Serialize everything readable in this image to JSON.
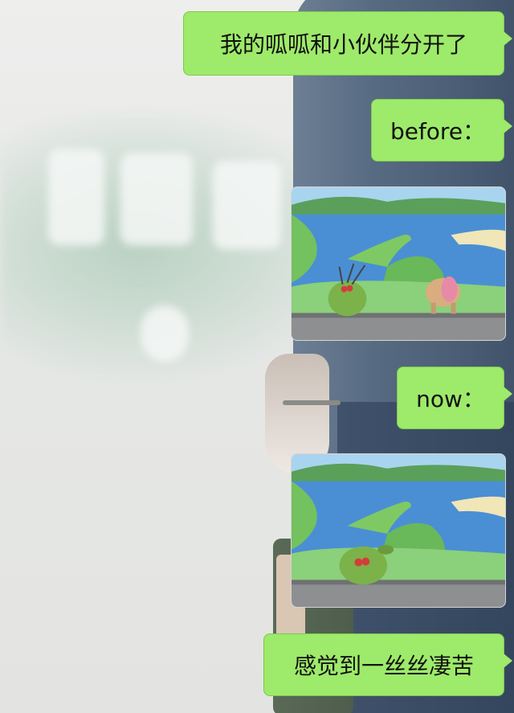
{
  "messages": [
    {
      "type": "text",
      "text": "我的呱呱和小伙伴分开了"
    },
    {
      "type": "text",
      "text": "before："
    },
    {
      "type": "image",
      "image": "frog-and-friend-looking-at-sea-icon"
    },
    {
      "type": "text",
      "text": "now："
    },
    {
      "type": "image",
      "image": "frog-alone-looking-at-sea-icon"
    },
    {
      "type": "text",
      "text": "感觉到一丝丝凄苦"
    }
  ],
  "colors": {
    "bubble": "#9eea6a",
    "bubble_border": "#7dc752",
    "sea": "#4a8fd4",
    "land": "#6fbf5a",
    "frog": "#7cb24a"
  }
}
